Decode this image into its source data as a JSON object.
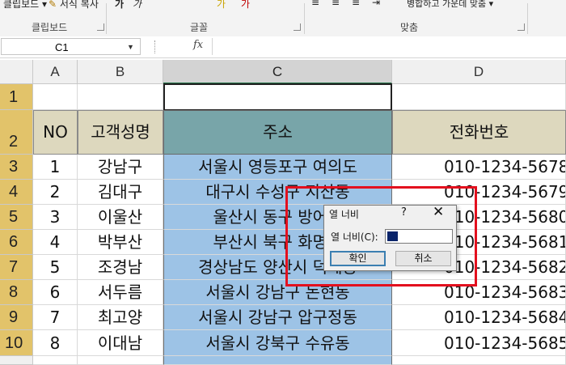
{
  "ribbon": {
    "top_items": [
      "클립보드 ▾",
      "서식 복사",
      "가",
      "가",
      "가",
      "가",
      "병합하고 가운데 맞춤 ▾"
    ],
    "groups": [
      "클립보드",
      "글꼴",
      "맞춤"
    ]
  },
  "formula_bar": {
    "name_box": "C1",
    "fx": "fx",
    "value": ""
  },
  "columns": [
    "A",
    "B",
    "C",
    "D"
  ],
  "rows": [
    "1",
    "2",
    "3",
    "4",
    "5",
    "6",
    "7",
    "8",
    "9",
    "10"
  ],
  "table": {
    "headers": {
      "no": "NO",
      "name": "고객성명",
      "address": "주소",
      "phone": "전화번호"
    },
    "records": [
      {
        "no": "1",
        "name": "강남구",
        "address": "서울시 영등포구 여의도",
        "phone": "010-1234-5678"
      },
      {
        "no": "2",
        "name": "김대구",
        "address": "대구시 수성구 지산동",
        "phone": "010-1234-5679"
      },
      {
        "no": "3",
        "name": "이울산",
        "address": "울산시 동구 방어동",
        "phone": "010-1234-5680"
      },
      {
        "no": "4",
        "name": "박부산",
        "address": "부산시 북구 화명동",
        "phone": "010-1234-5681"
      },
      {
        "no": "5",
        "name": "조경남",
        "address": "경상남도 양산시 덕계동",
        "phone": "010-1234-5682"
      },
      {
        "no": "6",
        "name": "서두름",
        "address": "서울시 강남구 논현동",
        "phone": "010-1234-5683"
      },
      {
        "no": "7",
        "name": "최고양",
        "address": "서울시 강남구 압구정동",
        "phone": "010-1234-5684"
      },
      {
        "no": "8",
        "name": "이대남",
        "address": "서울시 강북구 수유동",
        "phone": "010-1234-5685"
      }
    ]
  },
  "dialog": {
    "title": "열 너비",
    "help": "?",
    "close": "✕",
    "label": "열 너비(C):",
    "ok": "확인",
    "cancel": "취소"
  },
  "colors": {
    "accent": "#217346",
    "highlight_box": "#e3101e",
    "column_fill": "#9dc3e6",
    "header_fill": "#ddd8be"
  }
}
